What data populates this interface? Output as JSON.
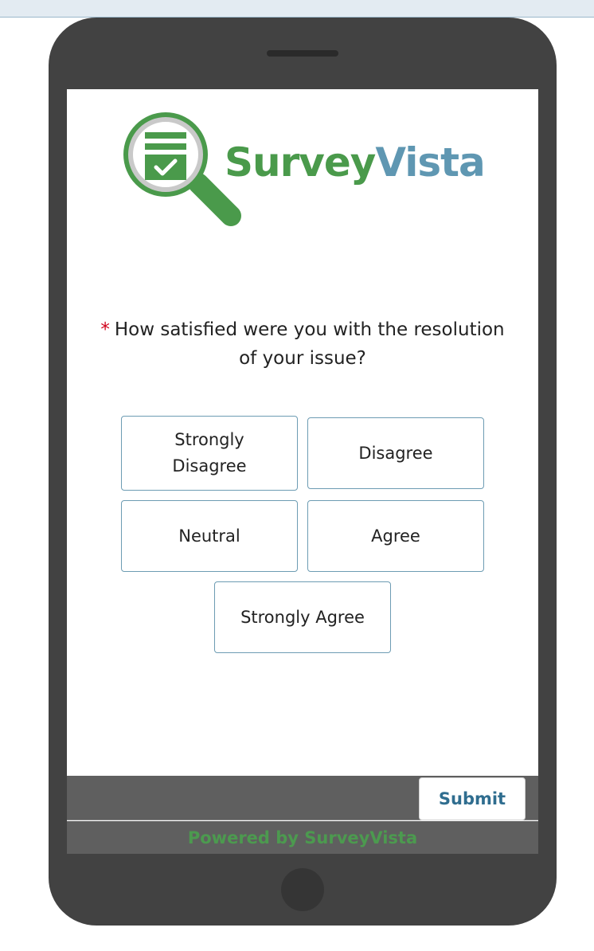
{
  "brand": {
    "name_part1": "Survey",
    "name_part2": "Vista",
    "color_green": "#4a9a4b",
    "color_blue": "#5f97b2"
  },
  "question": {
    "required_marker": "*",
    "text": "How satisfied were you with the resolution of your issue?"
  },
  "options": [
    {
      "label": "Strongly Disagree"
    },
    {
      "label": "Disagree"
    },
    {
      "label": "Neutral"
    },
    {
      "label": "Agree"
    },
    {
      "label": "Strongly Agree"
    }
  ],
  "footer": {
    "submit_label": "Submit",
    "powered_by": "Powered by SurveyVista"
  }
}
